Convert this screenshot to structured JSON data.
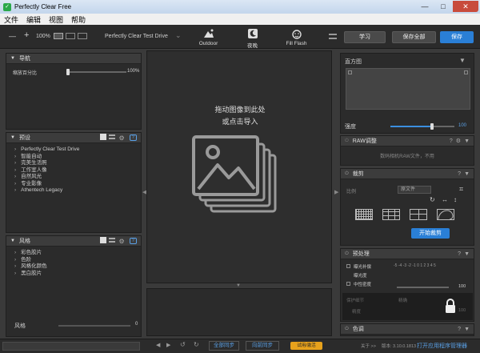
{
  "window": {
    "title": "Perfectly Clear Free",
    "minimize": "—",
    "maximize": "□",
    "close": "✕"
  },
  "menu": [
    "文件",
    "编辑",
    "视图",
    "帮助"
  ],
  "toolbar": {
    "minus": "—",
    "plus": "+",
    "zoom": "100%",
    "preset_name": "Perfectly Clear Test Drive",
    "presets": [
      {
        "label": "Outdoor",
        "icon": "outdoor-icon"
      },
      {
        "label": "夜晚",
        "icon": "night-icon"
      },
      {
        "label": "Fill Flash",
        "icon": "fill-flash-icon"
      }
    ],
    "learn": "学习",
    "save_all": "保存全部",
    "save": "保存"
  },
  "nav": {
    "title": "导航",
    "zoom_label": "缩放百分比",
    "zoom_value": "100%",
    "zoom_fraction": 0.0
  },
  "presets": {
    "title": "预设",
    "items": [
      "Perfectly Clear Test Drive",
      "智能自动",
      "完美生活照",
      "工作室人像",
      "自然风光",
      "专业影像",
      "Athentech Legacy"
    ]
  },
  "styles": {
    "title": "风格",
    "items": [
      "彩色胶片",
      "色阶",
      "风格化颜色",
      "黑白胶片"
    ],
    "footer_label": "风格",
    "footer_value": "0"
  },
  "canvas": {
    "drop_line1": "拖动图像到此处",
    "drop_line2": "或点击导入"
  },
  "bottom": {
    "sync_all": "全部同步",
    "sync_forward": "向前同步",
    "trial": "试用/激活",
    "about": "关于 >>",
    "version": "版本: 3.10.0.1813",
    "open_manager": "打开应用程序管理器"
  },
  "histogram": {
    "title": "直方图",
    "strength_label": "强度",
    "strength_value": "100",
    "strength_fraction": 0.65
  },
  "raw": {
    "title": "RAW调整",
    "note": "数码相机RAW文件，不用"
  },
  "crop": {
    "title": "裁剪",
    "ratio_label": "比例",
    "ratio_value": "原文件",
    "start": "开始裁剪"
  },
  "preprocess": {
    "title": "预处理",
    "row1": "曝光补偿",
    "row1_scale": "-5 -4 -3 -2 -1 0 1 2 3 4 5",
    "row2": "曝光度",
    "row3": "中性密度",
    "row3_value": "100",
    "row4": "保护细节",
    "row4_value": "精确",
    "row5": "精度",
    "row5_value": "100"
  },
  "color": {
    "title": "色调"
  },
  "colors": {
    "accent": "#2a7fd6",
    "bg": "#2b2b2b",
    "trial": "#e8a21c"
  }
}
